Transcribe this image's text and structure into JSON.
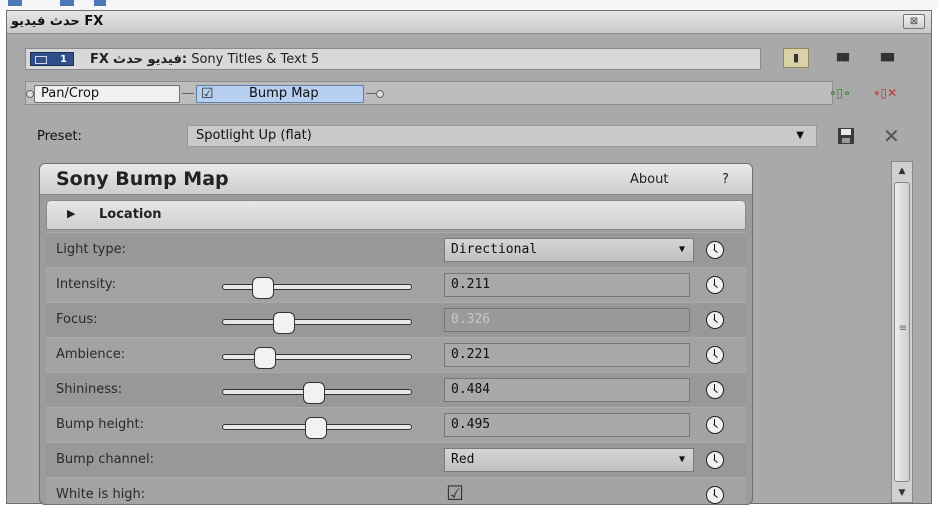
{
  "window": {
    "title": "حدث فيديو FX",
    "close_glyph": "⊠"
  },
  "chain": {
    "badge_number": "1",
    "title_fx": "FX",
    "title_arabic": "فيديو  حدث:",
    "title_name": "Sony Titles & Text 5"
  },
  "view_buttons": [
    "▮",
    "▮▮▮",
    "▮▮▮▮"
  ],
  "plugins": [
    {
      "label": "Pan/Crop"
    },
    {
      "label": "Bump Map",
      "checked": true
    }
  ],
  "chain_icons": [
    "plugin-chain-icon",
    "remove-plugin-icon"
  ],
  "preset": {
    "label": "Preset:",
    "value": "Spotlight Up (flat)"
  },
  "panel": {
    "title": "Sony Bump Map",
    "about": "About",
    "help": "?",
    "section": "Location"
  },
  "params": [
    {
      "label": "Light type:",
      "type": "dropdown",
      "value": "Directional"
    },
    {
      "label": "Intensity:",
      "type": "slider",
      "value": "0.211",
      "level": 0.211
    },
    {
      "label": "Focus:",
      "type": "slider",
      "value": "0.326",
      "level": 0.326,
      "disabled": true
    },
    {
      "label": "Ambience:",
      "type": "slider",
      "value": "0.221",
      "level": 0.221
    },
    {
      "label": "Shininess:",
      "type": "slider",
      "value": "0.484",
      "level": 0.484
    },
    {
      "label": "Bump height:",
      "type": "slider",
      "value": "0.495",
      "level": 0.495
    },
    {
      "label": "Bump channel:",
      "type": "dropdown",
      "value": "Red"
    },
    {
      "label": "White is high:",
      "type": "checkbox",
      "value": true
    }
  ],
  "colors": {
    "accent": "#b7cff0",
    "panel_bg": "#9c9c9c",
    "window_bg": "#a9a9a9"
  }
}
